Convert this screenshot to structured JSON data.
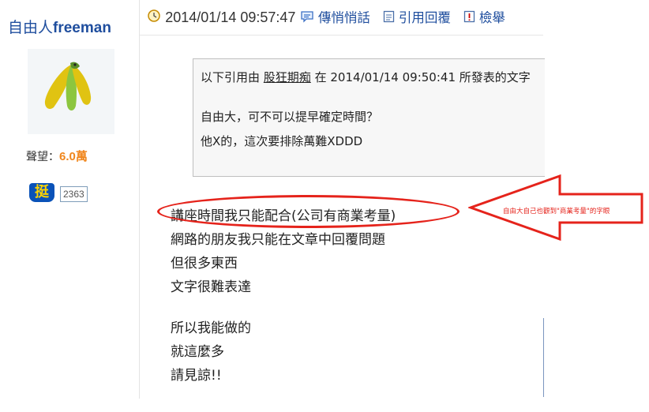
{
  "user": {
    "name_cjk": "自由人",
    "name_latin": "freeman",
    "reputation_label": "聲望：",
    "reputation_value": "6.0萬",
    "badge_char": "挺",
    "badge_count": "2363"
  },
  "post_header": {
    "timestamp": "2014/01/14 09:57:47",
    "whisper_link": "傳悄悄話",
    "reply_quote_link": "引用回覆",
    "report_link": "檢舉"
  },
  "quote": {
    "prefix": "以下引用由",
    "quoted_user": "股狂期痴",
    "in_word": "在",
    "quoted_time": "2014/01/14 09:50:41",
    "suffix": "所發表的文字",
    "lines": [
      "自由大，可不可以提早確定時間？",
      "他X的，這次要排除萬難XDDD"
    ]
  },
  "body": {
    "paragraph1": [
      "講座時間我只能配合(公司有商業考量)",
      "網路的朋友我只能在文章中回覆問題",
      "但很多東西",
      "文字很難表達"
    ],
    "paragraph2": [
      "所以我能做的",
      "就這麼多",
      "請見諒!!"
    ]
  },
  "annotation": {
    "text": "自由大自己也觀到\"商業考量\"的字眼",
    "color": "#e5231b"
  },
  "colors": {
    "link": "#1f4e9e",
    "reputation": "#f0861c",
    "badge_bg": "#0a52b8"
  }
}
